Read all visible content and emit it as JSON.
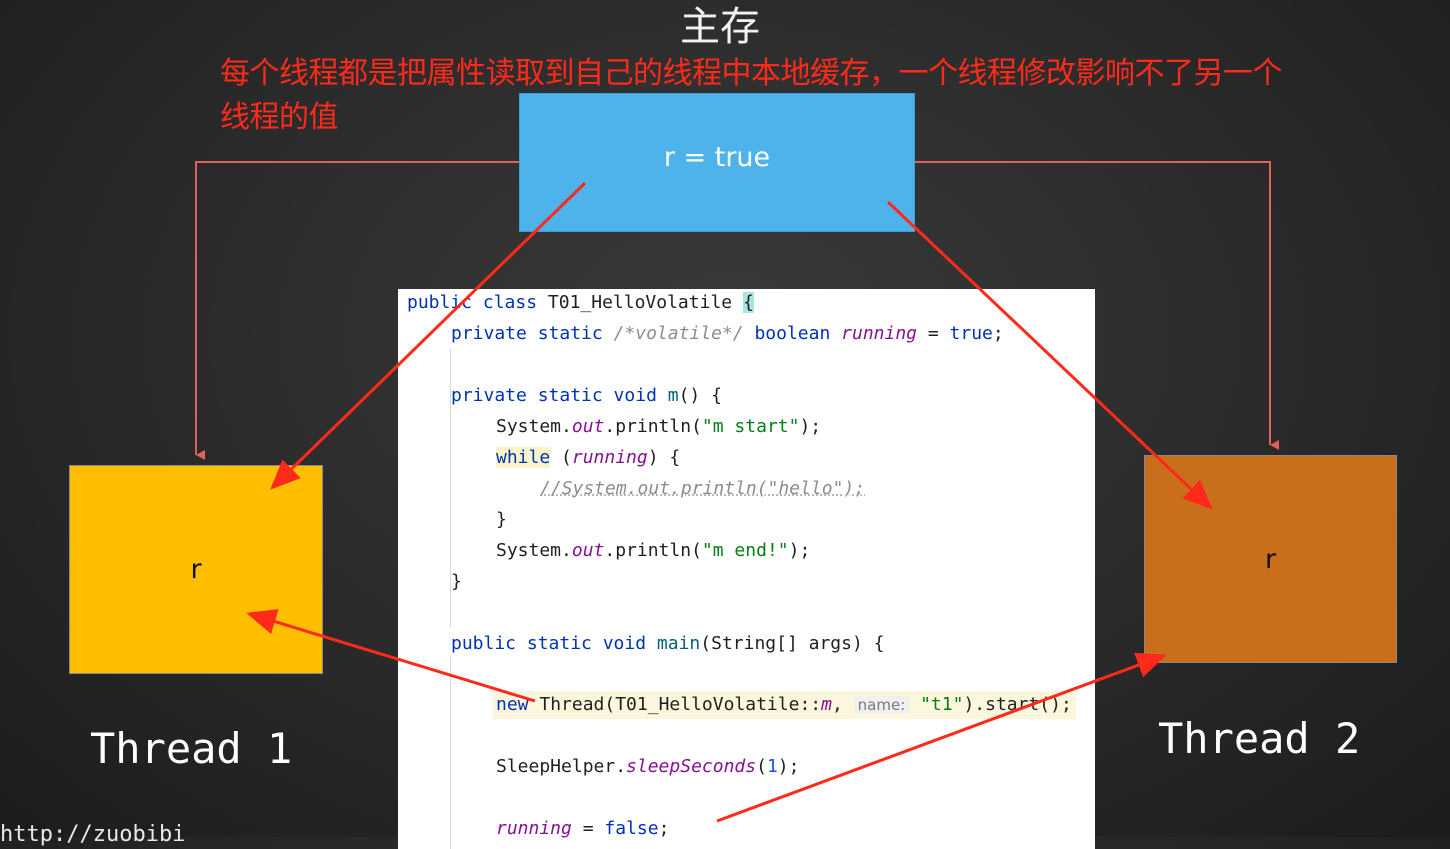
{
  "title": "主存",
  "annotation": "每个线程都是把属性读取到自己的线程中本地缓存，一个线程修改影响不了另一个线程的值",
  "main_memory": {
    "value": "r = true"
  },
  "thread1": {
    "box_label": "r",
    "name": "Thread 1"
  },
  "thread2": {
    "box_label": "r",
    "name": "Thread 2"
  },
  "code": {
    "line1": [
      "public class ",
      "T01_HelloVolatile ",
      "{"
    ],
    "line2": [
      "private static ",
      "/*volatile*/ ",
      "boolean ",
      "running",
      " = ",
      "true",
      ";"
    ],
    "line3": [
      "private static void ",
      "m",
      "() {"
    ],
    "line4": [
      "System.",
      "out",
      ".println(",
      "\"m start\"",
      ");"
    ],
    "line5": [
      "while",
      " (",
      "running",
      ") {"
    ],
    "line6": [
      "//System.out.println(\"hello\");"
    ],
    "line7": [
      "}"
    ],
    "line8": [
      "System.",
      "out",
      ".println(",
      "\"m end!\"",
      ");"
    ],
    "line9": [
      "}"
    ],
    "line10": [
      "public static void ",
      "main",
      "(String[] args) {"
    ],
    "line11": [
      "new ",
      "Thread(T01_HelloVolatile::",
      "m",
      ", ",
      "name:",
      " \"t1\"",
      ").start();"
    ],
    "line12": [
      "SleepHelper.",
      "sleepSeconds",
      "(",
      "1",
      ");"
    ],
    "line13": [
      "running",
      " = ",
      "false",
      ";"
    ]
  },
  "watermark": "http://zuobibi",
  "colors": {
    "background": "#2a2a2a",
    "main_memory": "#4db3ea",
    "thread1": "#ffbf00",
    "thread2": "#c96f1c",
    "annotation_text": "#ff2a1a",
    "arrow_red": "#ff2a1a",
    "connector": "#e0605a"
  }
}
